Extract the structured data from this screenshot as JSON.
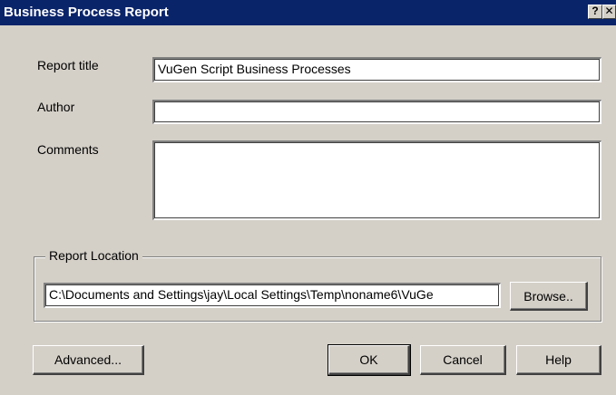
{
  "window": {
    "title": "Business Process Report",
    "help_glyph": "?",
    "close_glyph": "✕"
  },
  "form": {
    "report_title_label": "Report title",
    "report_title_value": "VuGen Script Business Processes",
    "author_label": "Author",
    "author_value": "",
    "comments_label": "Comments",
    "comments_value": ""
  },
  "location": {
    "group_label": "Report Location",
    "path_value": "C:\\Documents and Settings\\jay\\Local Settings\\Temp\\noname6\\VuGe",
    "browse_label": "Browse.."
  },
  "buttons": {
    "advanced": "Advanced...",
    "ok": "OK",
    "cancel": "Cancel",
    "help": "Help"
  }
}
